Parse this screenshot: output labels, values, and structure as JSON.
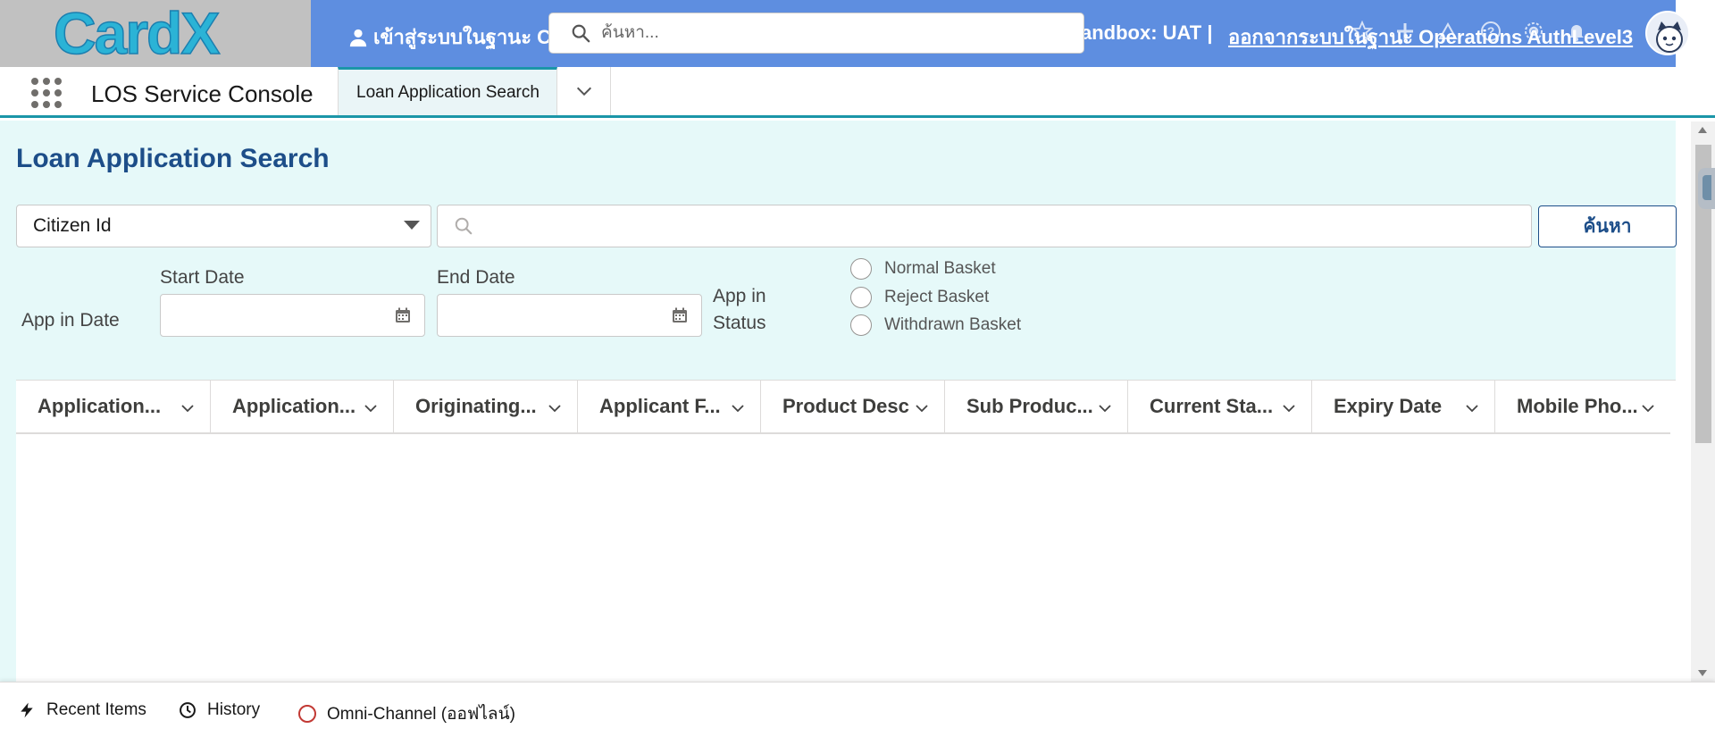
{
  "header": {
    "logo_text": "CardX",
    "impersonation_text": "เข้าสู่ระบบในฐานะ C",
    "sandbox_text": "andbox: UAT |",
    "logout_text": "ออกจากระบบในฐานะ Operations AuthLevel3",
    "search_placeholder": "ค้นหา...",
    "icons": [
      "favorites-icon",
      "add-icon",
      "trailhead-icon",
      "help-icon",
      "setup-icon",
      "notifications-icon"
    ]
  },
  "nav": {
    "app_name": "LOS Service Console",
    "active_tab": "Loan Application Search"
  },
  "page": {
    "title": "Loan Application Search",
    "search_type_value": "Citizen Id",
    "search_button_label": "ค้นหา",
    "app_in_date_label": "App in Date",
    "start_date_label": "Start Date",
    "end_date_label": "End Date",
    "app_in_status_label": "App in Status",
    "status_options": [
      "Normal Basket",
      "Reject Basket",
      "Withdrawn Basket"
    ]
  },
  "table": {
    "columns": [
      "Application...",
      "Application...",
      "Originating...",
      "Applicant F...",
      "Product Desc",
      "Sub Produc...",
      "Current Sta...",
      "Expiry Date",
      "Mobile Pho..."
    ],
    "rows": []
  },
  "utility_bar": {
    "recent_items": "Recent Items",
    "history": "History",
    "omni_channel": "Omni-Channel (ออฟไลน์)"
  },
  "colors": {
    "header_blue": "#5e8ee0",
    "content_bg": "#e6f9f9",
    "title_blue": "#1d4e89",
    "tab_accent": "#1b96a8",
    "omni_offline": "#c23934"
  }
}
